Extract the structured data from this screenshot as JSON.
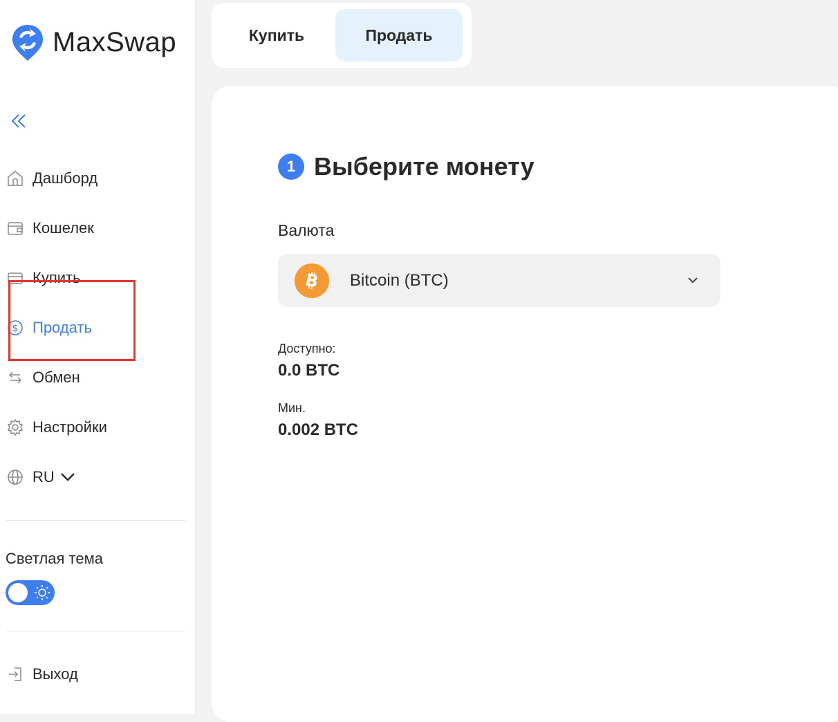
{
  "brand": {
    "name": "MaxSwap",
    "color": "#3d7ef0"
  },
  "sidebar": {
    "collapse_icon": "double-chevron-left-icon",
    "items": [
      {
        "label": "Дашборд",
        "icon": "home-icon"
      },
      {
        "label": "Кошелек",
        "icon": "wallet-icon"
      },
      {
        "label": "Купить",
        "icon": "card-icon"
      },
      {
        "label": "Продать",
        "icon": "dollar-circle-icon",
        "active": true
      },
      {
        "label": "Обмен",
        "icon": "exchange-icon"
      },
      {
        "label": "Настройки",
        "icon": "gear-icon"
      },
      {
        "label": "RU",
        "icon": "globe-icon"
      }
    ],
    "theme_label": "Светлая тема",
    "theme_toggle_on": true,
    "logout_label": "Выход"
  },
  "tabs": [
    {
      "label": "Купить",
      "selected": false
    },
    {
      "label": "Продать",
      "selected": true
    }
  ],
  "main": {
    "step_number": "1",
    "step_title": "Выберите монету",
    "currency_label": "Валюта",
    "currency_value": "Bitcoin (BTC)",
    "available_label": "Доступно:",
    "available_value": "0.0 BTC",
    "min_label": "Мин.",
    "min_value": "0.002 BTC"
  },
  "colors": {
    "accent": "#3d7ef0",
    "bitcoin": "#f39a34",
    "highlight": "#e2392c",
    "tab_selected_bg": "#e5f1fd"
  }
}
